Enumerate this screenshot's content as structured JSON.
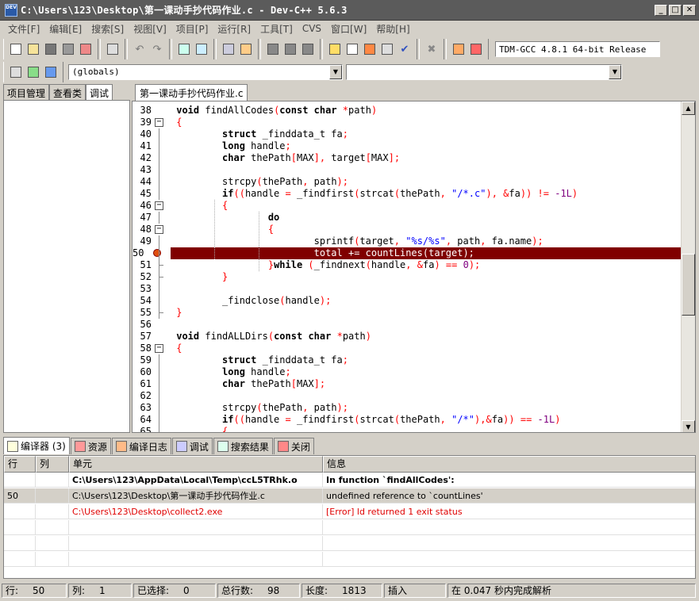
{
  "window": {
    "title": "C:\\Users\\123\\Desktop\\第一课动手抄代码作业.c - Dev-C++ 5.6.3",
    "icon_label": "DEV",
    "buttons": {
      "minimize": "_",
      "maximize": "□",
      "close": "✕"
    }
  },
  "menu": {
    "items": [
      "文件[F]",
      "编辑[E]",
      "搜索[S]",
      "视图[V]",
      "项目[P]",
      "运行[R]",
      "工具[T]",
      "CVS",
      "窗口[W]",
      "帮助[H]"
    ]
  },
  "toolbar": {
    "compiler": "TDM-GCC 4.8.1 64-bit Release",
    "scope_combo": "(globals)",
    "function_combo": ""
  },
  "left_panel": {
    "tabs": [
      "项目管理",
      "查看类",
      "调试"
    ],
    "active_tab": 2
  },
  "editor": {
    "tab_label": "第一课动手抄代码作业.c",
    "highlight_line": 50,
    "lines": [
      {
        "n": "38",
        "t": "void findAllCodes(const char *path)"
      },
      {
        "n": "39",
        "t": "{"
      },
      {
        "n": "40",
        "t": "        struct _finddata_t fa;"
      },
      {
        "n": "41",
        "t": "        long handle;"
      },
      {
        "n": "42",
        "t": "        char thePath[MAX], target[MAX];"
      },
      {
        "n": "43",
        "t": ""
      },
      {
        "n": "44",
        "t": "        strcpy(thePath, path);"
      },
      {
        "n": "45",
        "t": "        if((handle = _findfirst(strcat(thePath, \"/*.c\"), &fa)) != -1L)"
      },
      {
        "n": "46",
        "t": "        {"
      },
      {
        "n": "47",
        "t": "                do"
      },
      {
        "n": "48",
        "t": "                {"
      },
      {
        "n": "49",
        "t": "                        sprintf(target, \"%s/%s\", path, fa.name);"
      },
      {
        "n": "50",
        "t": "                        total += countLines(target);"
      },
      {
        "n": "51",
        "t": "                }while (_findnext(handle, &fa) == 0);"
      },
      {
        "n": "52",
        "t": "        }"
      },
      {
        "n": "53",
        "t": ""
      },
      {
        "n": "54",
        "t": "        _findclose(handle);"
      },
      {
        "n": "55",
        "t": "}"
      },
      {
        "n": "56",
        "t": ""
      },
      {
        "n": "57",
        "t": "void findALLDirs(const char *path)"
      },
      {
        "n": "58",
        "t": "{"
      },
      {
        "n": "59",
        "t": "        struct _finddata_t fa;"
      },
      {
        "n": "60",
        "t": "        long handle;"
      },
      {
        "n": "61",
        "t": "        char thePath[MAX];"
      },
      {
        "n": "62",
        "t": ""
      },
      {
        "n": "63",
        "t": "        strcpy(thePath, path);"
      },
      {
        "n": "64",
        "t": "        if((handle = _findfirst(strcat(thePath, \"/*\"),&fa)) == -1L)"
      },
      {
        "n": "65",
        "t": "        {"
      }
    ]
  },
  "bottom_tabs": [
    "编译器 (3)",
    "资源",
    "编译日志",
    "调试",
    "搜索结果",
    "关闭"
  ],
  "messages": {
    "headers": [
      "行",
      "列",
      "单元",
      "信息"
    ],
    "rows": [
      {
        "line": "",
        "col": "",
        "unit": "C:\\Users\\123\\AppData\\Local\\Temp\\ccL5TRhk.o",
        "msg": "In function `findAllCodes':"
      },
      {
        "line": "50",
        "col": "",
        "unit": "C:\\Users\\123\\Desktop\\第一课动手抄代码作业.c",
        "msg": "undefined reference to `countLines'"
      },
      {
        "line": "",
        "col": "",
        "unit": "C:\\Users\\123\\Desktop\\collect2.exe",
        "msg": "[Error] ld returned 1 exit status"
      }
    ]
  },
  "status": {
    "line_label": "行:",
    "line_val": "50",
    "col_label": "列:",
    "col_val": "1",
    "sel_label": "已选择:",
    "sel_val": "0",
    "total_label": "总行数:",
    "total_val": "98",
    "len_label": "长度:",
    "len_val": "1813",
    "mode": "插入",
    "parse": "在 0.047 秒内完成解析"
  },
  "colors": {
    "highlight": "#800000",
    "error_text": "#e00000",
    "string": "#0000ff",
    "operator": "#ff0000"
  }
}
